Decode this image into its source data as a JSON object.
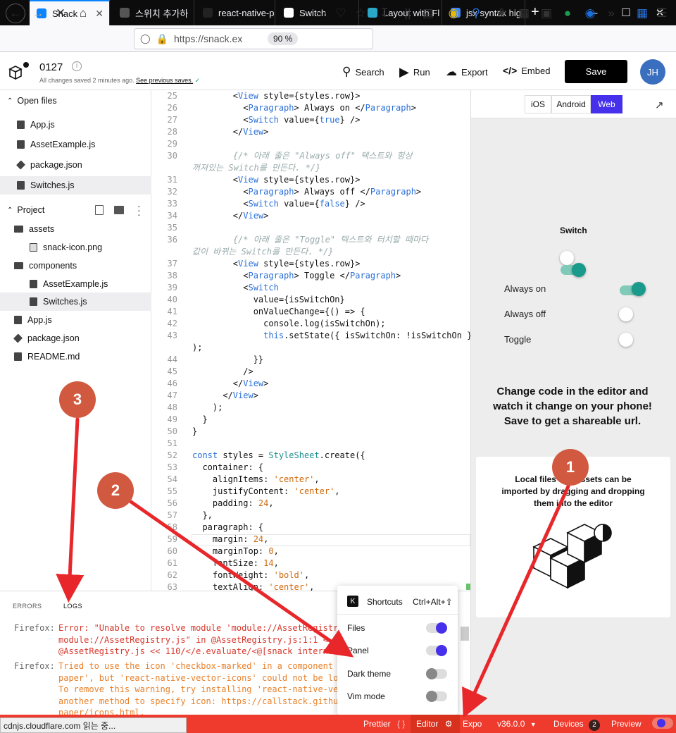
{
  "browser": {
    "tabs": [
      {
        "label": "Snack",
        "active": true
      },
      {
        "label": "스위치 추가하"
      },
      {
        "label": "react-native-p"
      },
      {
        "label": "Switch"
      },
      {
        "label": "Layout with Fl"
      },
      {
        "label": "jsx syntax hig"
      }
    ],
    "url": "https://snack.ex",
    "zoom": "90 %"
  },
  "snack": {
    "title": "0127",
    "saved_status": "All changes saved 2 minutes ago.",
    "saved_link": "See previous saves.",
    "search": "Search",
    "run": "Run",
    "export": "Export",
    "embed": "Embed",
    "save": "Save",
    "avatar": "JH"
  },
  "sidebar": {
    "open_files_header": "Open files",
    "open_files": [
      "App.js",
      "AssetExample.js",
      "package.json",
      "Switches.js"
    ],
    "project_header": "Project",
    "tree": [
      {
        "label": "assets",
        "type": "folder",
        "depth": 1
      },
      {
        "label": "snack-icon.png",
        "type": "image",
        "depth": 2
      },
      {
        "label": "components",
        "type": "folder",
        "depth": 1
      },
      {
        "label": "AssetExample.js",
        "type": "file",
        "depth": 2
      },
      {
        "label": "Switches.js",
        "type": "file",
        "depth": 2,
        "selected": true
      },
      {
        "label": "App.js",
        "type": "file",
        "depth": 1
      },
      {
        "label": "package.json",
        "type": "pkg",
        "depth": 1
      },
      {
        "label": "README.md",
        "type": "file",
        "depth": 1
      }
    ]
  },
  "editor": {
    "lines": [
      {
        "n": "25",
        "t": "        <View style={styles.row}>"
      },
      {
        "n": "26",
        "t": "          <Paragraph> Always on </Paragraph>"
      },
      {
        "n": "27",
        "t": "          <Switch value={true} />"
      },
      {
        "n": "28",
        "t": "        </View>"
      },
      {
        "n": "29",
        "t": ""
      },
      {
        "n": "30",
        "t": "        {/* 아래 줄은 \"Always off\" 텍스트와 항상"
      },
      {
        "n": "",
        "t": "꺼져있는 Switch를 만든다. */}"
      },
      {
        "n": "31",
        "t": "        <View style={styles.row}>"
      },
      {
        "n": "32",
        "t": "          <Paragraph> Always off </Paragraph>"
      },
      {
        "n": "33",
        "t": "          <Switch value={false} />"
      },
      {
        "n": "34",
        "t": "        </View>"
      },
      {
        "n": "35",
        "t": ""
      },
      {
        "n": "36",
        "t": "        {/* 아래 줄은 \"Toggle\" 텍스트와 터치할 때마다"
      },
      {
        "n": "",
        "t": "값이 바뀌는 Switch를 만든다. */}"
      },
      {
        "n": "37",
        "t": "        <View style={styles.row}>"
      },
      {
        "n": "38",
        "t": "          <Paragraph> Toggle </Paragraph>"
      },
      {
        "n": "39",
        "t": "          <Switch"
      },
      {
        "n": "40",
        "t": "            value={isSwitchOn}"
      },
      {
        "n": "41",
        "t": "            onValueChange={() => {"
      },
      {
        "n": "42",
        "t": "              console.log(isSwitchOn);"
      },
      {
        "n": "43",
        "t": "              this.setState({ isSwitchOn: !isSwitchOn }"
      },
      {
        "n": "",
        "t": ");"
      },
      {
        "n": "44",
        "t": "            }}"
      },
      {
        "n": "45",
        "t": "          />"
      },
      {
        "n": "46",
        "t": "        </View>"
      },
      {
        "n": "47",
        "t": "      </View>"
      },
      {
        "n": "48",
        "t": "    );"
      },
      {
        "n": "49",
        "t": "  }"
      },
      {
        "n": "50",
        "t": "}"
      },
      {
        "n": "51",
        "t": ""
      },
      {
        "n": "52",
        "t": "const styles = StyleSheet.create({"
      },
      {
        "n": "53",
        "t": "  container: {"
      },
      {
        "n": "54",
        "t": "    alignItems: 'center',"
      },
      {
        "n": "55",
        "t": "    justifyContent: 'center',"
      },
      {
        "n": "56",
        "t": "    padding: 24,"
      },
      {
        "n": "57",
        "t": "  },"
      },
      {
        "n": "58",
        "t": "  paragraph: {"
      },
      {
        "n": "59",
        "t": "    margin: 24,"
      },
      {
        "n": "60",
        "t": "    marginTop: 0,"
      },
      {
        "n": "61",
        "t": "    fontSize: 14,"
      },
      {
        "n": "62",
        "t": "    fontWeight: 'bold',"
      },
      {
        "n": "63",
        "t": "    textAlign: 'center',"
      }
    ]
  },
  "preview": {
    "platforms": [
      "iOS",
      "Android",
      "Web"
    ],
    "active_platform": "Web",
    "switch_title": "Switch",
    "rows": [
      {
        "label": "Always on",
        "on": true
      },
      {
        "label": "Always off",
        "on": false
      },
      {
        "label": "Toggle",
        "on": false
      }
    ],
    "message": "Change code in the editor and watch it change on your phone! Save to get a shareable url.",
    "card_text": "Local files and assets can be imported by dragging and dropping them into the editor"
  },
  "panel": {
    "tabs": [
      "ERRORS",
      "LOGS"
    ],
    "logs": [
      {
        "src": "Firefox:",
        "lines": [
          "Error: \"Unable to resolve module 'module://AssetRegistry.js'",
          "module://AssetRegistry.js\" in @AssetRegistry.js:1:1 <-",
          "@AssetRegistry.js << 110/</e.evaluate/<@[snack internals]"
        ]
      },
      {
        "src": "Firefox:",
        "lines": [
          "Tried to use the icon 'checkbox-marked' in a component from react-native-",
          "paper', but 'react-native-vector-icons' could not be loaded.",
          "To remove this warning, try installing 'react-native-vector-icons' or use",
          "another method to specify icon: https://callstack.github.io/react-native-",
          "paper/icons.html."
        ]
      }
    ]
  },
  "popup": {
    "shortcuts_key": "K",
    "shortcuts": "Shortcuts",
    "shortcuts_hotkey": "Ctrl+Alt+⇧",
    "options": [
      {
        "label": "Files",
        "on": true
      },
      {
        "label": "Panel",
        "on": true
      },
      {
        "label": "Dark theme",
        "on": false
      },
      {
        "label": "Vim mode",
        "on": false
      }
    ]
  },
  "statusbar": {
    "loading": "cdnjs.cloudflare.com 읽는 중...",
    "prettier": "Prettier",
    "prettier_icon": "{ }",
    "editor": "Editor",
    "expo": "Expo",
    "version": "v36.0.0",
    "devices": "Devices",
    "devices_count": "2",
    "preview": "Preview"
  },
  "annotations": [
    "1",
    "2",
    "3"
  ],
  "colors": {
    "accent": "#4630eb",
    "status": "#ee3b2e",
    "switch_on": "#1a9a8a",
    "annotation": "#e8272b",
    "badge": "#d1593f"
  }
}
